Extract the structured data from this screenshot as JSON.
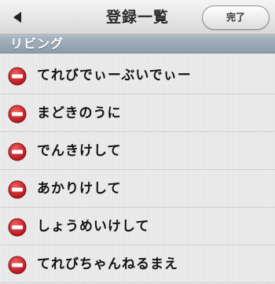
{
  "nav": {
    "title": "登録一覧",
    "done_label": "完了",
    "back_icon": "back-arrow-icon"
  },
  "section": {
    "label": "リビング"
  },
  "devices": [
    {
      "label": "てれびでぃーぶいでぃー",
      "icon": "delete-minus-icon"
    },
    {
      "label": "まどきのうに",
      "icon": "delete-minus-icon"
    },
    {
      "label": "でんきけして",
      "icon": "delete-minus-icon"
    },
    {
      "label": "あかりけして",
      "icon": "delete-minus-icon"
    },
    {
      "label": "しょうめいけして",
      "icon": "delete-minus-icon"
    },
    {
      "label": "てれびちゃんねるまえ",
      "icon": "delete-minus-icon"
    }
  ],
  "colors": {
    "delete_red": "#d2232a",
    "section_blue_gray": "#98a8b7",
    "nav_bar": "#e6e6e6"
  }
}
